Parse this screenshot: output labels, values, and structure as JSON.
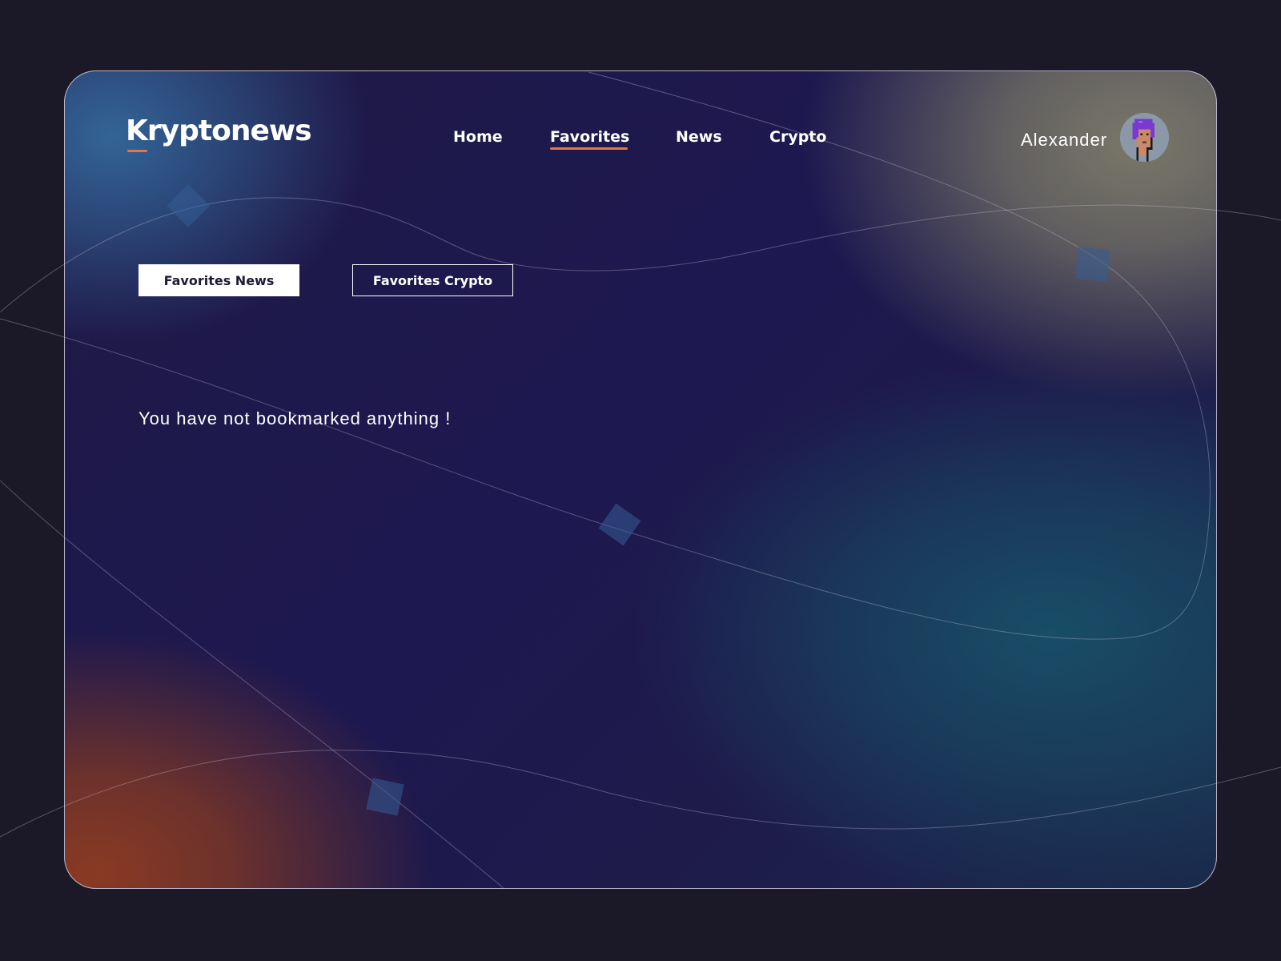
{
  "header": {
    "logo": "Kryptonews",
    "nav": [
      {
        "label": "Home",
        "active": false
      },
      {
        "label": "Favorites",
        "active": true
      },
      {
        "label": "News",
        "active": false
      },
      {
        "label": "Crypto",
        "active": false
      }
    ],
    "user": {
      "name": "Alexander",
      "avatar_icon": "pixel-avatar-icon"
    }
  },
  "tabs": [
    {
      "label": "Favorites News",
      "selected": true
    },
    {
      "label": "Favorites Crypto",
      "selected": false
    }
  ],
  "main": {
    "empty_message": "You have not bookmarked anything !"
  },
  "colors": {
    "accent": "#e2764a",
    "background": "#1b1928",
    "card_base": "#1d1850",
    "text": "#ffffff",
    "tab_selected_text": "#1d1b36"
  }
}
